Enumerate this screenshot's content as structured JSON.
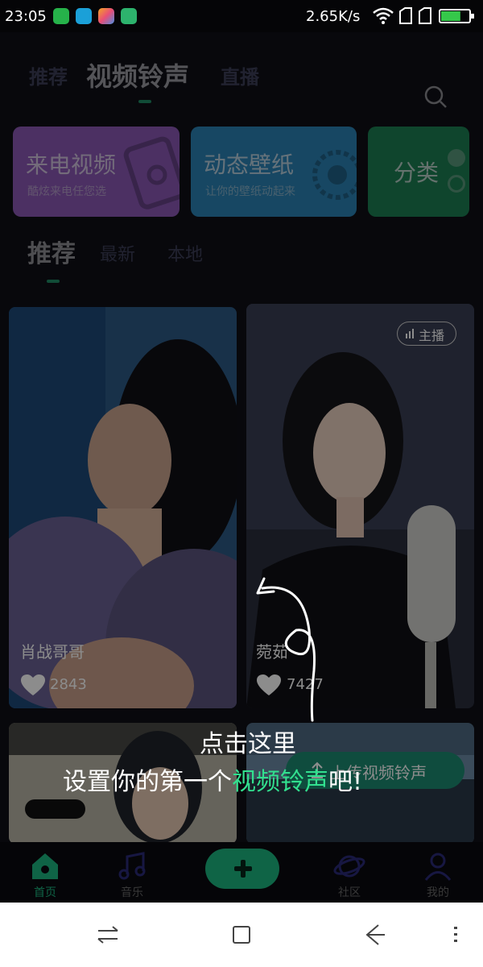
{
  "status_bar": {
    "time": "23:05",
    "network_speed": "2.65K/s",
    "battery_level": 0.7
  },
  "top_tabs": [
    {
      "label": "推荐",
      "active": false
    },
    {
      "label": "视频铃声",
      "active": true
    },
    {
      "label": "直播",
      "active": false
    }
  ],
  "feature_cards": [
    {
      "title": "来电视频",
      "subtitle": "酷炫来电任您选",
      "color": "#8a58b5"
    },
    {
      "title": "动态壁纸",
      "subtitle": "让你的壁纸动起来",
      "color": "#2a82b5"
    },
    {
      "title": "分类",
      "subtitle": "",
      "color": "#1d7f52"
    }
  ],
  "sub_tabs": [
    {
      "label": "推荐",
      "active": true
    },
    {
      "label": "最新",
      "active": false
    },
    {
      "label": "本地",
      "active": false
    }
  ],
  "videos": [
    {
      "name": "肖战哥哥",
      "likes": "2843",
      "badge": ""
    },
    {
      "name": "菀茹",
      "likes": "7427",
      "badge": "主播"
    },
    {
      "name": "",
      "likes": "",
      "badge": ""
    },
    {
      "name": "",
      "likes": "",
      "badge": ""
    }
  ],
  "upload_button": {
    "label": "上传视频铃声"
  },
  "tip": {
    "line1": "点击这里",
    "line2_prefix": "设置你的第一个",
    "line2_highlight": "视频铃声",
    "line2_suffix": "吧!"
  },
  "bottom_nav": [
    {
      "label": "首页",
      "icon": "home-icon"
    },
    {
      "label": "音乐",
      "icon": "music-icon"
    },
    {
      "label": "",
      "icon": "add-icon"
    },
    {
      "label": "社区",
      "icon": "planet-icon"
    },
    {
      "label": "我的",
      "icon": "user-icon"
    }
  ],
  "colors": {
    "accent": "#1db780",
    "tip_highlight": "#32e08f"
  }
}
